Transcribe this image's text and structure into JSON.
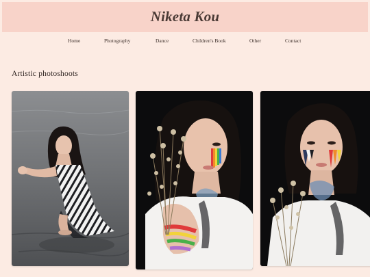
{
  "site": {
    "title": "Niketa Kou"
  },
  "nav": {
    "items": [
      {
        "label": "Home"
      },
      {
        "label": "Photography"
      },
      {
        "label": "Dance"
      },
      {
        "label": "Children's Book"
      },
      {
        "label": "Other"
      },
      {
        "label": "Contact"
      }
    ]
  },
  "main": {
    "section_title": "Artistic photoshoots",
    "photos": [
      {
        "subject": "woman crouching in water, tie-dye dress"
      },
      {
        "subject": "woman holding dried flowers with rainbow face paint"
      },
      {
        "subject": "woman with flower bouquet and painted face streaks"
      }
    ]
  },
  "colors": {
    "header_bg": "#f8d3c9",
    "page_bg": "#fcebe3",
    "text": "#3d2f2a"
  }
}
